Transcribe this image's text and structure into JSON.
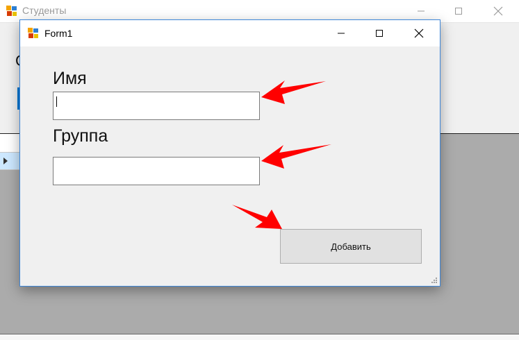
{
  "background_window": {
    "title": "Студенты",
    "stub_letter": "С"
  },
  "form": {
    "title": "Form1",
    "name_label": "Имя",
    "name_value": "",
    "group_label": "Группа",
    "group_value": "",
    "add_button_label": "Добавить"
  },
  "colors": {
    "accent_border": "#3d86d8",
    "annotation_arrow": "#ff0000",
    "grid_background": "#ababab"
  },
  "icons": [
    "app-icon",
    "minimize-icon",
    "maximize-icon",
    "close-icon",
    "row-selector-arrow-icon",
    "size-grip-icon"
  ]
}
